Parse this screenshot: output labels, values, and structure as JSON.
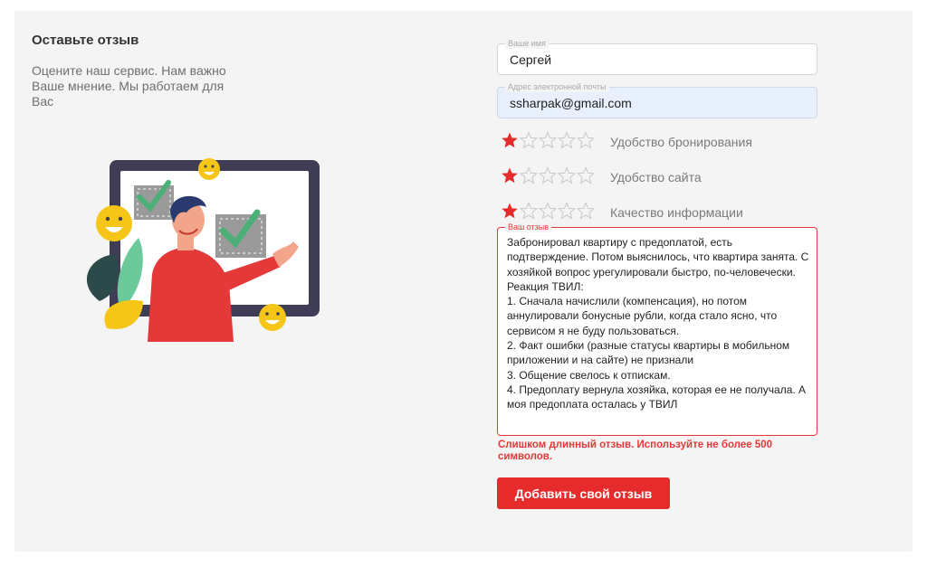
{
  "intro": {
    "title": "Оставьте отзыв",
    "text": "Оцените наш сервис. Нам важно Ваше мнение. Мы работаем для Вас"
  },
  "form": {
    "name": {
      "legend": "Ваше имя",
      "value": "Сергей"
    },
    "email": {
      "legend": "Адрес электронной почты",
      "value": "ssharpak@gmail.com"
    },
    "ratings": [
      {
        "label": "Удобство бронирования",
        "stars": 1,
        "max": 5
      },
      {
        "label": "Удобство сайта",
        "stars": 1,
        "max": 5
      },
      {
        "label": "Качество информации",
        "stars": 1,
        "max": 5
      }
    ],
    "review": {
      "legend": "Ваш отзыв",
      "value": "Забронировал квартиру с предоплатой, есть подтверждение. Потом выяснилось, что квартира занята. С хозяйкой вопрос урегулировали быстро, по-человечески. Реакция ТВИЛ:\n1. Сначала начислили (компенсация), но потом аннулировали бонусные рубли, когда стало ясно, что сервисом я не буду пользоваться.\n2. Факт ошибки (разные статусы квартиры в мобильном приложении и на сайте) не признали\n3. Общение свелось к отпискам.\n4. Предоплату вернула хозяйка, которая ее не получала. А моя предоплата осталась у ТВИЛ"
    },
    "error": "Слишком длинный отзыв. Используйте не более 500 символов.",
    "submit_label": "Добавить свой отзыв"
  },
  "colors": {
    "accent": "#e52b2b",
    "star_filled": "#e52b2b",
    "star_empty": "#c8c8c8",
    "panel_bg": "#f4f4f4"
  }
}
